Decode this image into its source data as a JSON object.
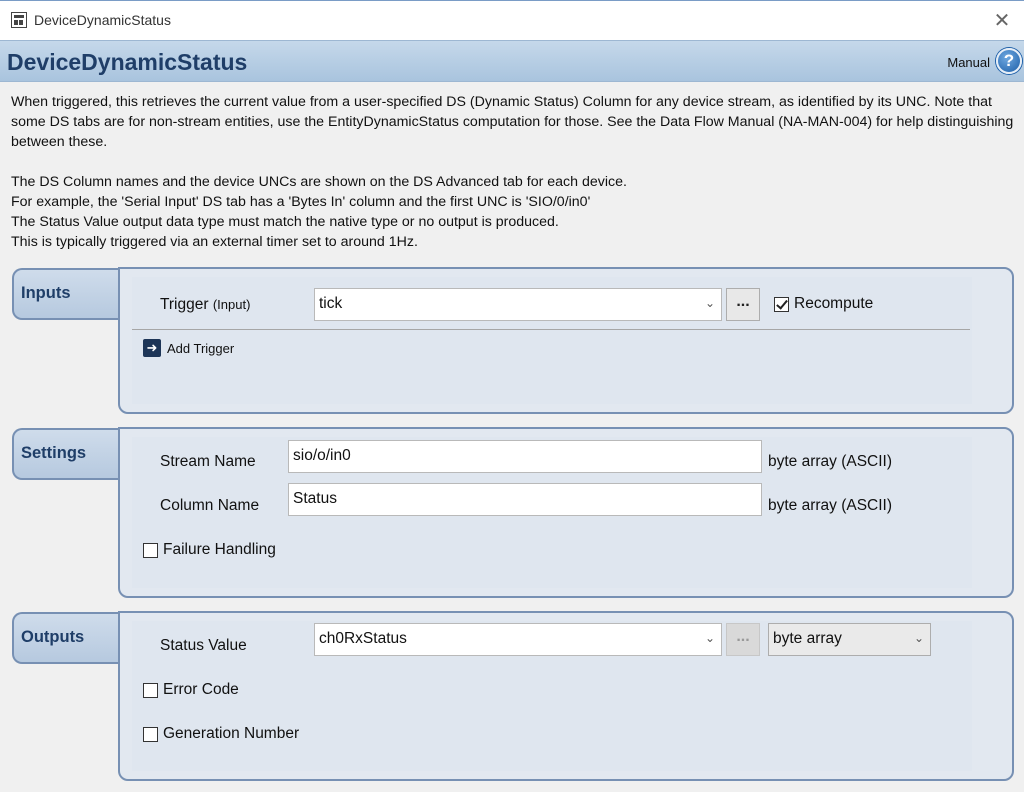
{
  "window": {
    "title": "DeviceDynamicStatus",
    "close_glyph": "✕"
  },
  "header": {
    "title": "DeviceDynamicStatus",
    "manual_label": "Manual",
    "help_glyph": "?"
  },
  "description": {
    "paragraph1": "When triggered, this retrieves the current value from a user-specified DS (Dynamic Status) Column for any device stream, as identified by its UNC. Note that some DS tabs are for non-stream entities, use the EntityDynamicStatus computation for those. See the Data Flow Manual (NA-MAN-004) for help distinguishing between these.",
    "lines": [
      "The DS Column names and the device UNCs are shown on the DS Advanced tab for each device.",
      "For example, the 'Serial Input' DS tab has a 'Bytes In' column and the first UNC is 'SIO/0/in0'",
      "The Status Value output data type must match the native type or no output is produced.",
      "This is typically triggered via an external timer set to around 1Hz."
    ]
  },
  "inputs": {
    "tab_label": "Inputs",
    "trigger_label": "Trigger",
    "trigger_sublabel": "(Input)",
    "trigger_value": "tick",
    "ellipsis_label": "...",
    "recompute_label": "Recompute",
    "recompute_checked": true,
    "add_trigger_label": "Add Trigger"
  },
  "settings": {
    "tab_label": "Settings",
    "stream_name_label": "Stream Name",
    "stream_name_value": "sio/o/in0",
    "stream_name_type": "byte array (ASCII)",
    "column_name_label": "Column Name",
    "column_name_value": "Status",
    "column_name_type": "byte array (ASCII)",
    "failure_handling_label": "Failure Handling",
    "failure_handling_checked": false
  },
  "outputs": {
    "tab_label": "Outputs",
    "status_value_label": "Status Value",
    "status_value_value": "ch0RxStatus",
    "ellipsis_label": "...",
    "type_value": "byte array",
    "error_code_label": "Error Code",
    "error_code_checked": false,
    "generation_number_label": "Generation Number",
    "generation_number_checked": false
  },
  "icons": {
    "dropdown": "chevron-down-icon",
    "help": "help-circle-icon",
    "add": "arrow-right-icon",
    "app": "app-window-icon"
  }
}
